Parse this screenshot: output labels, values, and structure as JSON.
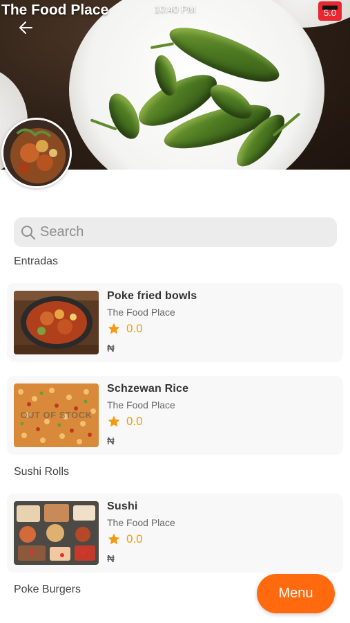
{
  "status_bar": {
    "time": "10:40 PM",
    "battery": "5.0"
  },
  "restaurant": {
    "title": "The Food Place"
  },
  "search": {
    "placeholder": "Search"
  },
  "sections": [
    {
      "title": "Entradas",
      "items": [
        {
          "name": "Poke fried bowls",
          "place": "The Food Place",
          "rating": "0.0",
          "price": "₦",
          "badge": ""
        },
        {
          "name": "Schzewan Rice",
          "place": "The Food Place",
          "rating": "0.0",
          "price": "₦",
          "badge": "OUT OF STOCK"
        }
      ]
    },
    {
      "title": "Sushi Rolls",
      "items": [
        {
          "name": "Sushi",
          "place": "The Food Place",
          "rating": "0.0",
          "price": "₦",
          "badge": ""
        }
      ]
    },
    {
      "title": "Poke Burgers",
      "items": []
    }
  ],
  "menu_button": {
    "label": "Menu"
  },
  "colors": {
    "accent": "#ff6a0e",
    "star": "#f39a10",
    "battery": "#e8272f"
  },
  "icons": [
    "back-arrow-icon",
    "search-icon",
    "star-icon"
  ]
}
